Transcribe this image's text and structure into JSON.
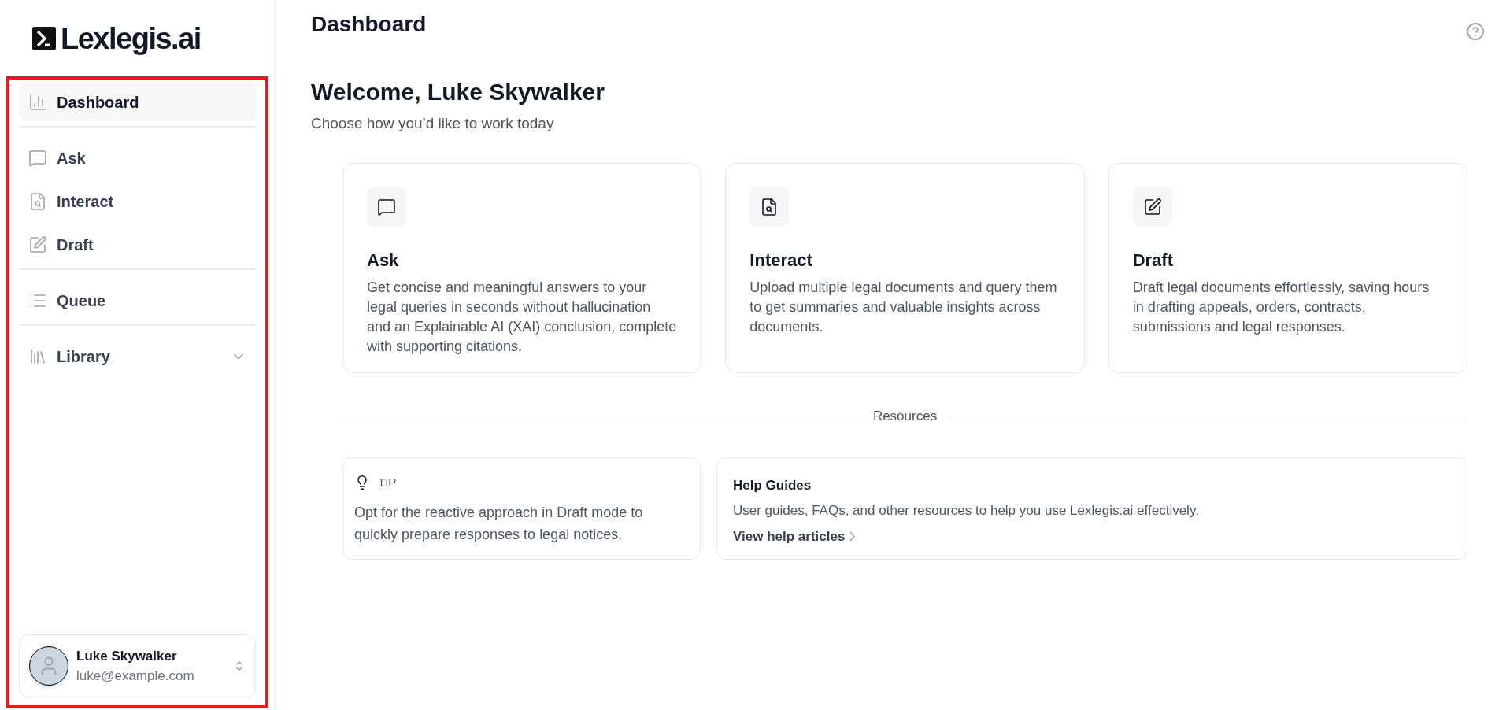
{
  "logo": {
    "text": "Lexlegis.ai"
  },
  "nav_groups": [
    [
      {
        "label": "Dashboard",
        "selected": true
      }
    ],
    [
      {
        "label": "Ask",
        "selected": false
      },
      {
        "label": "Interact",
        "selected": false
      },
      {
        "label": "Draft",
        "selected": false
      }
    ],
    [
      {
        "label": "Queue",
        "selected": false
      }
    ],
    [
      {
        "label": "Library",
        "selected": false,
        "expanded": false
      }
    ]
  ],
  "user": {
    "name": "Luke Skywalker",
    "email": "luke@example.com"
  },
  "page_title": "Dashboard",
  "welcome": {
    "title": "Welcome, Luke Skywalker",
    "subtitle": "Choose how you’d like to work today"
  },
  "modes": [
    {
      "title": "Ask",
      "description": "Get concise and meaningful answers to your legal queries in seconds without hallucination and an Explainable AI (XAI) conclusion, complete with supporting citations."
    },
    {
      "title": "Interact",
      "description": "Upload multiple legal documents and query them to get summaries and valuable insights across documents."
    },
    {
      "title": "Draft",
      "description": "Draft legal documents effortlessly, saving hours in drafting appeals, orders, contracts, submissions and legal responses."
    }
  ],
  "resources_label": "Resources",
  "tip": {
    "label": "TIP",
    "text": "Opt for the reactive approach in Draft mode to quickly prepare responses to legal notices."
  },
  "help": {
    "title": "Help Guides",
    "text": "User guides, FAQs, and other resources to help you use Lexlegis.ai effectively.",
    "link": "View help articles"
  }
}
